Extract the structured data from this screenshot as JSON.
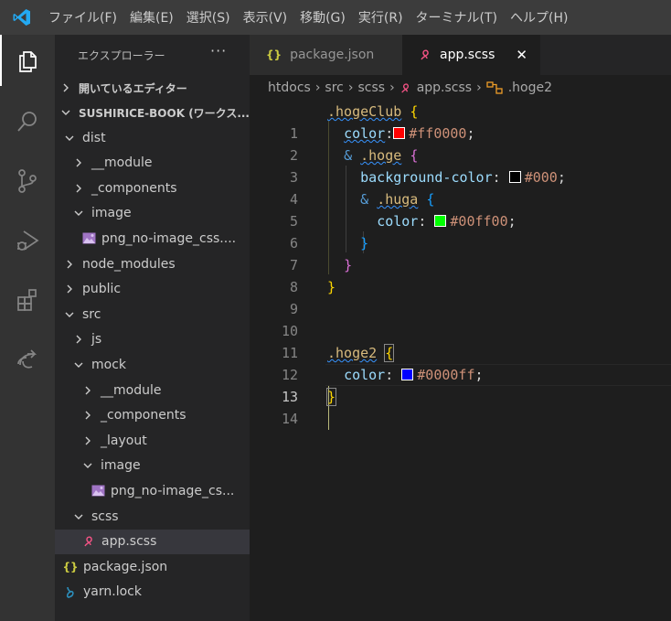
{
  "menubar": {
    "items": [
      "ファイル(F)",
      "編集(E)",
      "選択(S)",
      "表示(V)",
      "移動(G)",
      "実行(R)",
      "ターミナル(T)",
      "ヘルプ(H)"
    ]
  },
  "activity_bar": {
    "icons": [
      "files-icon",
      "search-icon",
      "source-control-icon",
      "run-debug-icon",
      "extensions-icon",
      "live-share-icon"
    ]
  },
  "sidebar": {
    "title": "エクスプローラー",
    "more": "···",
    "open_editors_label": "開いているエディター",
    "workspace_label": "SUSHIRICE-BOOK (ワークス...",
    "tree": [
      {
        "label": "dist",
        "indent": 1,
        "chevron": "down",
        "icon": ""
      },
      {
        "label": "__module",
        "indent": 2,
        "chevron": "right",
        "icon": ""
      },
      {
        "label": "_components",
        "indent": 2,
        "chevron": "right",
        "icon": ""
      },
      {
        "label": "image",
        "indent": 2,
        "chevron": "down",
        "icon": ""
      },
      {
        "label": "png_no-image_css....",
        "indent": 3,
        "chevron": "",
        "icon": "image"
      },
      {
        "label": "node_modules",
        "indent": 1,
        "chevron": "right",
        "icon": ""
      },
      {
        "label": "public",
        "indent": 1,
        "chevron": "right",
        "icon": ""
      },
      {
        "label": "src",
        "indent": 1,
        "chevron": "down",
        "icon": ""
      },
      {
        "label": "js",
        "indent": 2,
        "chevron": "right",
        "icon": ""
      },
      {
        "label": "mock",
        "indent": 2,
        "chevron": "down",
        "icon": ""
      },
      {
        "label": "__module",
        "indent": 3,
        "chevron": "right",
        "icon": ""
      },
      {
        "label": "_components",
        "indent": 3,
        "chevron": "right",
        "icon": ""
      },
      {
        "label": "_layout",
        "indent": 3,
        "chevron": "right",
        "icon": ""
      },
      {
        "label": "image",
        "indent": 3,
        "chevron": "down",
        "icon": ""
      },
      {
        "label": "png_no-image_cs...",
        "indent": 4,
        "chevron": "",
        "icon": "image"
      },
      {
        "label": "scss",
        "indent": 2,
        "chevron": "down",
        "icon": ""
      },
      {
        "label": "app.scss",
        "indent": 3,
        "chevron": "",
        "icon": "scss",
        "selected": true
      },
      {
        "label": "package.json",
        "indent": 1,
        "chevron": "",
        "icon": "json"
      },
      {
        "label": "yarn.lock",
        "indent": 1,
        "chevron": "",
        "icon": "yarn"
      }
    ]
  },
  "tabs": [
    {
      "label": "package.json",
      "icon": "{}"
    },
    {
      "label": "app.scss",
      "icon": "scss",
      "close": "✕",
      "active": true
    }
  ],
  "breadcrumb": {
    "parts": [
      "htdocs",
      "src",
      "scss",
      "app.scss",
      ".hoge2"
    ]
  },
  "editor": {
    "line_numbers": [
      "1",
      "2",
      "3",
      "4",
      "5",
      "6",
      "7",
      "8",
      "9",
      "10",
      "11",
      "12",
      "13",
      "14"
    ],
    "current_line": 13,
    "colors": {
      "swatch_red": "#ff0000",
      "swatch_black": "#000000",
      "swatch_green": "#00ff00",
      "swatch_blue": "#0000ff"
    },
    "code": {
      "l1_sel": ".hogeClub",
      "l2_prop": "color",
      "l2_val": "#ff0000",
      "l3_amp": "&",
      "l3_sel": ".hoge",
      "l4_prop": "background-color",
      "l4_val": "#000",
      "l5_amp": "&",
      "l5_sel": ".huga",
      "l6_prop": "color",
      "l6_val": "#00ff00",
      "l12_sel": ".hoge2",
      "l13_prop": "color",
      "l13_val": "#0000ff"
    }
  }
}
